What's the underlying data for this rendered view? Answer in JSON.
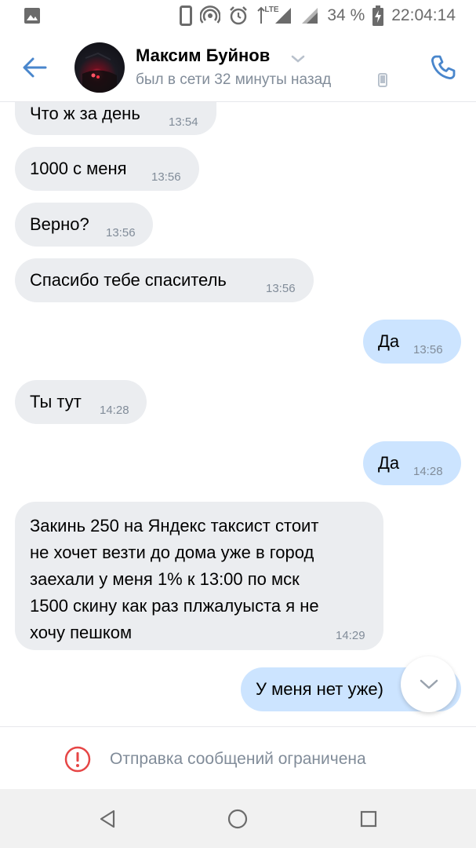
{
  "status_bar": {
    "lte": "LTE",
    "battery": "34 %",
    "time": "22:04:14",
    "icons": [
      "image-icon",
      "phone-outline-icon",
      "hotspot-icon",
      "alarm-icon",
      "data-arrows-icon",
      "signal-icon",
      "signal-icon",
      "battery-charging-icon"
    ]
  },
  "header": {
    "contact_name": "Максим Буйнов",
    "last_seen": "был в сети 32 минуты назад",
    "accent_color": "#4986cc"
  },
  "messages": [
    {
      "direction": "in",
      "text": "Что ж за день",
      "time": "13:54"
    },
    {
      "direction": "in",
      "text": "1000 с меня",
      "time": "13:56"
    },
    {
      "direction": "in",
      "text": "Верно?",
      "time": "13:56"
    },
    {
      "direction": "in",
      "text": "Спасибо тебе спаситель",
      "time": "13:56"
    },
    {
      "direction": "out",
      "text": "Да",
      "time": "13:56"
    },
    {
      "direction": "in",
      "text": "Ты тут",
      "time": "14:28"
    },
    {
      "direction": "out",
      "text": "Да",
      "time": "14:28"
    },
    {
      "direction": "in",
      "lines": [
        "Закинь 250 на Яндекс таксист стоит",
        "не хочет везти до дома уже в город",
        "заехали у меня 1% к 13:00 по мск",
        "1500 скину как раз плжалуыста я не",
        "хочу пешком"
      ],
      "time": "14:29"
    },
    {
      "direction": "out",
      "text": "У меня нет уже)",
      "time": ""
    }
  ],
  "restriction": {
    "text": "Отправка сообщений ограничена",
    "icon_color": "#e64646"
  },
  "colors": {
    "incoming_bubble": "#ebedf0",
    "outgoing_bubble": "#cce4ff",
    "secondary_text": "#818c99"
  }
}
